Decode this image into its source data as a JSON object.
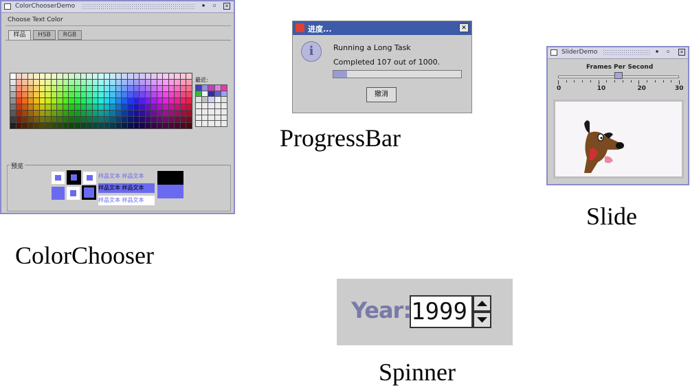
{
  "color_chooser": {
    "window_title": "ColorChooserDemo",
    "group_title": "Choose Text Color",
    "tabs": [
      "样品",
      "HSB",
      "RGB"
    ],
    "recent_label": "最近:",
    "preview_label": "预览",
    "sample_text": "样品文本",
    "caption": "ColorChooser"
  },
  "progress_dialog": {
    "window_title": "进度...",
    "close_glyph": "✕",
    "message": "Running a Long Task",
    "status": "Completed 107 out of 1000.",
    "progress_value": 107,
    "progress_max": 1000,
    "cancel_label": "撤消",
    "caption": "ProgressBar"
  },
  "slider_window": {
    "window_title": "SliderDemo",
    "slider_label": "Frames Per Second",
    "tick_labels": [
      "0",
      "10",
      "20",
      "30"
    ],
    "value": 15,
    "max": 30,
    "caption": "Slide"
  },
  "spinner": {
    "label": "Year:",
    "value": "1999",
    "caption": "Spinner"
  },
  "colors": {
    "metal_accent": "#8a8acb",
    "progress_fill": "#9a9ad4",
    "dialog_title": "#3d5ba8"
  }
}
